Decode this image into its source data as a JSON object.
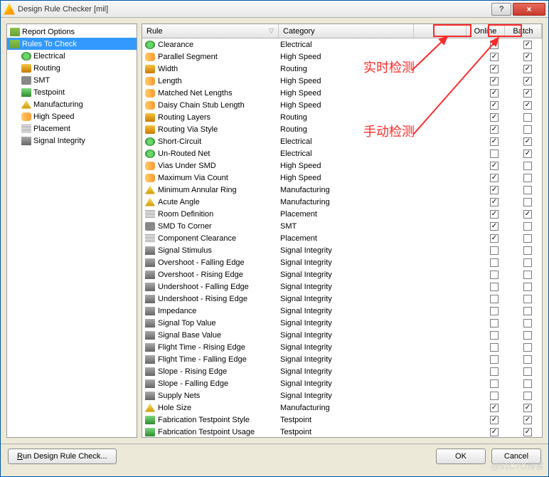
{
  "window": {
    "title": "Design Rule Checker [mil]",
    "help_icon": "?",
    "close_icon": "×"
  },
  "tree": {
    "items": [
      {
        "label": "Report Options",
        "icon": "ic-folder",
        "indent": 0,
        "selected": false
      },
      {
        "label": "Rules To Check",
        "icon": "ic-folder",
        "indent": 0,
        "selected": true
      },
      {
        "label": "Electrical",
        "icon": "ic-elec",
        "indent": 1,
        "selected": false
      },
      {
        "label": "Routing",
        "icon": "ic-rout",
        "indent": 1,
        "selected": false
      },
      {
        "label": "SMT",
        "icon": "ic-smt",
        "indent": 1,
        "selected": false
      },
      {
        "label": "Testpoint",
        "icon": "ic-tp",
        "indent": 1,
        "selected": false
      },
      {
        "label": "Manufacturing",
        "icon": "ic-mf",
        "indent": 1,
        "selected": false
      },
      {
        "label": "High Speed",
        "icon": "ic-hs",
        "indent": 1,
        "selected": false
      },
      {
        "label": "Placement",
        "icon": "ic-pl",
        "indent": 1,
        "selected": false
      },
      {
        "label": "Signal Integrity",
        "icon": "ic-si",
        "indent": 1,
        "selected": false
      }
    ]
  },
  "grid": {
    "headers": {
      "rule": "Rule",
      "category": "Category",
      "online": "Online",
      "batch": "Batch",
      "sort_glyph": "▽"
    },
    "rows": [
      {
        "rule": "Clearance",
        "category": "Electrical",
        "icon": "ic-elec",
        "online": true,
        "batch": true
      },
      {
        "rule": "Parallel Segment",
        "category": "High Speed",
        "icon": "ic-hs",
        "online": true,
        "batch": true
      },
      {
        "rule": "Width",
        "category": "Routing",
        "icon": "ic-rout",
        "online": true,
        "batch": true
      },
      {
        "rule": "Length",
        "category": "High Speed",
        "icon": "ic-hs",
        "online": true,
        "batch": true
      },
      {
        "rule": "Matched Net Lengths",
        "category": "High Speed",
        "icon": "ic-hs",
        "online": true,
        "batch": true
      },
      {
        "rule": "Daisy Chain Stub Length",
        "category": "High Speed",
        "icon": "ic-hs",
        "online": true,
        "batch": true
      },
      {
        "rule": "Routing Layers",
        "category": "Routing",
        "icon": "ic-rout",
        "online": true,
        "batch": false
      },
      {
        "rule": "Routing Via Style",
        "category": "Routing",
        "icon": "ic-rout",
        "online": true,
        "batch": false
      },
      {
        "rule": "Short-Circuit",
        "category": "Electrical",
        "icon": "ic-elec",
        "online": true,
        "batch": true
      },
      {
        "rule": "Un-Routed Net",
        "category": "Electrical",
        "icon": "ic-elec",
        "online": false,
        "batch": true
      },
      {
        "rule": "Vias Under SMD",
        "category": "High Speed",
        "icon": "ic-hs",
        "online": true,
        "batch": false
      },
      {
        "rule": "Maximum Via Count",
        "category": "High Speed",
        "icon": "ic-hs",
        "online": true,
        "batch": false
      },
      {
        "rule": "Minimum Annular Ring",
        "category": "Manufacturing",
        "icon": "ic-mf",
        "online": true,
        "batch": false
      },
      {
        "rule": "Acute Angle",
        "category": "Manufacturing",
        "icon": "ic-mf",
        "online": true,
        "batch": false
      },
      {
        "rule": "Room Definition",
        "category": "Placement",
        "icon": "ic-pl",
        "online": true,
        "batch": true
      },
      {
        "rule": "SMD To Corner",
        "category": "SMT",
        "icon": "ic-smt",
        "online": true,
        "batch": false
      },
      {
        "rule": "Component Clearance",
        "category": "Placement",
        "icon": "ic-pl",
        "online": true,
        "batch": false
      },
      {
        "rule": "Signal Stimulus",
        "category": "Signal Integrity",
        "icon": "ic-si",
        "online": false,
        "batch": false
      },
      {
        "rule": "Overshoot - Falling Edge",
        "category": "Signal Integrity",
        "icon": "ic-si",
        "online": false,
        "batch": false
      },
      {
        "rule": "Overshoot - Rising Edge",
        "category": "Signal Integrity",
        "icon": "ic-si",
        "online": false,
        "batch": false
      },
      {
        "rule": "Undershoot - Falling Edge",
        "category": "Signal Integrity",
        "icon": "ic-si",
        "online": false,
        "batch": false
      },
      {
        "rule": "Undershoot - Rising Edge",
        "category": "Signal Integrity",
        "icon": "ic-si",
        "online": false,
        "batch": false
      },
      {
        "rule": "Impedance",
        "category": "Signal Integrity",
        "icon": "ic-si",
        "online": false,
        "batch": false
      },
      {
        "rule": "Signal Top Value",
        "category": "Signal Integrity",
        "icon": "ic-si",
        "online": false,
        "batch": false
      },
      {
        "rule": "Signal Base Value",
        "category": "Signal Integrity",
        "icon": "ic-si",
        "online": false,
        "batch": false
      },
      {
        "rule": "Flight Time - Rising Edge",
        "category": "Signal Integrity",
        "icon": "ic-si",
        "online": false,
        "batch": false
      },
      {
        "rule": "Flight Time - Falling Edge",
        "category": "Signal Integrity",
        "icon": "ic-si",
        "online": false,
        "batch": false
      },
      {
        "rule": "Slope - Rising Edge",
        "category": "Signal Integrity",
        "icon": "ic-si",
        "online": false,
        "batch": false
      },
      {
        "rule": "Slope - Falling Edge",
        "category": "Signal Integrity",
        "icon": "ic-si",
        "online": false,
        "batch": false
      },
      {
        "rule": "Supply Nets",
        "category": "Signal Integrity",
        "icon": "ic-si",
        "online": false,
        "batch": false
      },
      {
        "rule": "Hole Size",
        "category": "Manufacturing",
        "icon": "ic-mf",
        "online": true,
        "batch": true
      },
      {
        "rule": "Fabrication Testpoint Style",
        "category": "Testpoint",
        "icon": "ic-tp",
        "online": true,
        "batch": true
      },
      {
        "rule": "Fabrication Testpoint Usage",
        "category": "Testpoint",
        "icon": "ic-tp",
        "online": true,
        "batch": true
      }
    ]
  },
  "footer": {
    "run": "Run Design Rule Check...",
    "ok": "OK",
    "cancel": "Cancel"
  },
  "annotations": {
    "label_online": "实时检测",
    "label_batch": "手动检测"
  },
  "watermark": "@51CTO博客"
}
